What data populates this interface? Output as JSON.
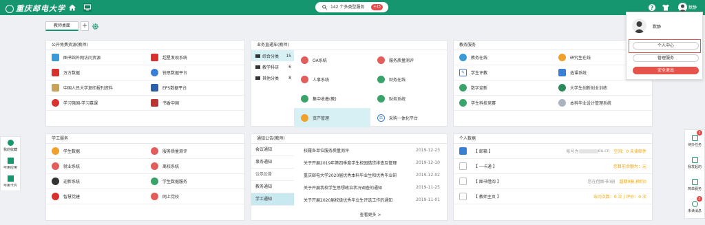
{
  "header": {
    "logo_text": "重庆邮电大学",
    "search_text": "142 个多类型服务",
    "search_badge": "+15",
    "user_name": "默静"
  },
  "tabs": {
    "active": "教师桌面",
    "add": "+"
  },
  "panels": {
    "resources": {
      "title": "公开免费资源(教师)",
      "rows": [
        [
          "图书馆外网访问资源",
          "超星发现系统"
        ],
        [
          "万方数据",
          "锐思数据平台"
        ],
        [
          "中国人民大学复印报刊资料",
          "EPS数据平台"
        ],
        [
          "学习强国-学习慕课",
          "书香中国"
        ]
      ]
    },
    "business": {
      "title": "业务直通车(教师)",
      "categories": [
        {
          "label": "综合分类",
          "count": "15"
        },
        {
          "label": "教学科研",
          "count": "6"
        },
        {
          "label": "其他分类",
          "count": "8"
        }
      ],
      "rows": [
        [
          "OA系统",
          "服务质量测评"
        ],
        [
          "人事系统",
          "财务在线"
        ],
        [
          "集中收缴(教)",
          "财务系统"
        ],
        [
          "资产管理",
          "采购一体化平台"
        ]
      ]
    },
    "teaching": {
      "title": "教务服务",
      "rows": [
        [
          "教务在线",
          "研究生在线"
        ],
        [
          "学生评教",
          "选课系统"
        ],
        [
          "数字迎新",
          "大学生创新创业训练"
        ],
        [
          "学生科技竞赛",
          "本科毕业设计管理系统"
        ]
      ]
    },
    "student": {
      "title": "学工服务",
      "rows": [
        [
          "学生数据",
          "服务质量测评"
        ],
        [
          "就业系统",
          "离校系统"
        ],
        [
          "迎新系统",
          "学生数据服务"
        ],
        [
          "智慧党建",
          "网上党校"
        ]
      ]
    },
    "notice": {
      "title": "通知公告(教师)",
      "categories": [
        "会议通知",
        "事务通知",
        "公示公告",
        "教务通知",
        "学工通知"
      ],
      "items": [
        {
          "title": "校履各单位服务质量测评",
          "date": "2019-12-23"
        },
        {
          "title": "关于开展2019年第四季度学生校园借贷排查及管理",
          "date": "2019-12-10"
        },
        {
          "title": "重庆邮电大学2020届优秀本科毕业生和优秀毕业研",
          "date": "2019-12-02"
        },
        {
          "title": "关于开展我校学生思想政治状况调查的通知",
          "date": "2019-11-25"
        },
        {
          "title": "关于开展2020届校级优秀毕业生评选工作的通知",
          "date": "2019-11-01"
        }
      ],
      "more": "查看更多 >"
    },
    "personal": {
      "title": "个人数据",
      "rows": [
        {
          "label": "【 邮箱 】",
          "mid": "帐号为",
          "mid2": "du.cn",
          "right": "空间：0 未读邮件"
        },
        {
          "label": "【 一卡通 】",
          "mid": "",
          "mid2": "",
          "right": "您目前余额为：元"
        },
        {
          "label": "【 图书借阅 】",
          "mid": "您在借图书0册",
          "mid2": "",
          "right": "超期0册,预约0"
        },
        {
          "label": "【 教师主页 】",
          "mid": "",
          "mid2": "",
          "right": "访问次数：0 次 | 评价：0 次"
        }
      ]
    }
  },
  "left_sidebar": [
    "我的收藏",
    "可用应用",
    "可用卡片"
  ],
  "right_sidebar": [
    {
      "label": "待办任务",
      "badge": "2"
    },
    {
      "label": "我发起的",
      "badge": ""
    },
    {
      "label": "简单服务",
      "badge": ""
    },
    {
      "label": "未读消息",
      "badge": "2"
    }
  ],
  "popover": {
    "name": "默静",
    "buttons": [
      "个人中心",
      "管理服务",
      "安全退出"
    ]
  },
  "colors": {
    "brand": "#15966e",
    "accent": "#e5534b"
  }
}
